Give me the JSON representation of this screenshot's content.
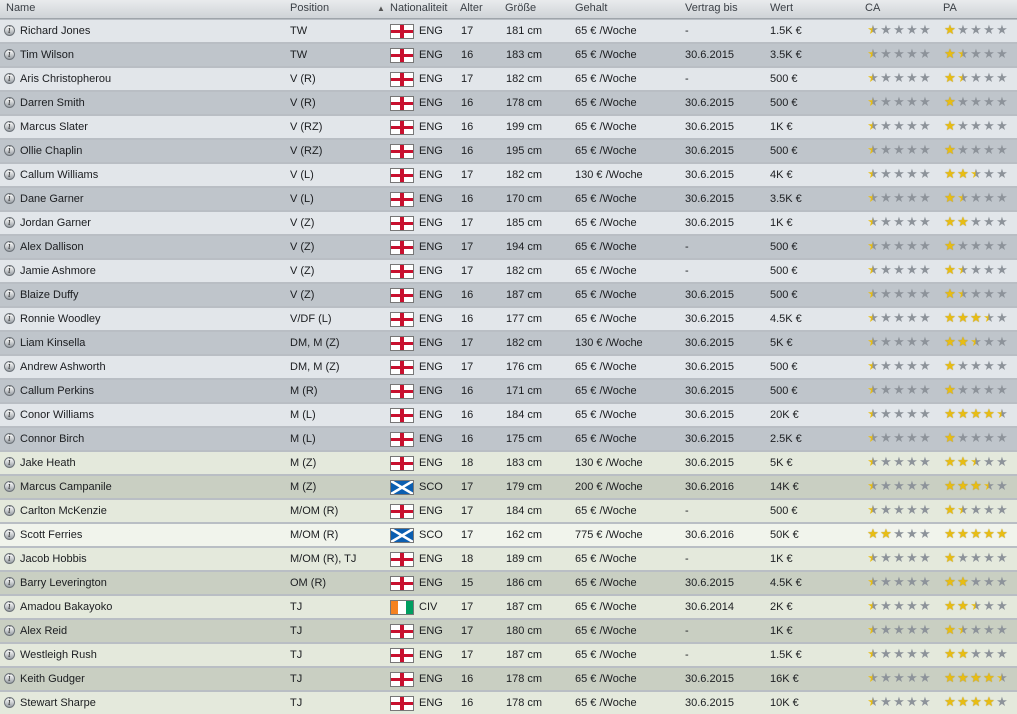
{
  "columns": [
    {
      "key": "name",
      "label": "Name"
    },
    {
      "key": "position",
      "label": "Position"
    },
    {
      "key": "nat",
      "label": "Nationaliteit"
    },
    {
      "key": "age",
      "label": "Alter"
    },
    {
      "key": "height",
      "label": "Größe"
    },
    {
      "key": "salary",
      "label": "Gehalt"
    },
    {
      "key": "contract",
      "label": "Vertrag bis"
    },
    {
      "key": "value",
      "label": "Wert"
    },
    {
      "key": "ca",
      "label": "CA"
    },
    {
      "key": "pa",
      "label": "PA"
    }
  ],
  "info_icon_glyph": "i",
  "sort_glyph": "▲",
  "star_glyph": "★",
  "colors": {
    "star_gold": "#e8bd13",
    "star_grey": "#8d939a",
    "eng_red": "#c8102e",
    "sco_blue": "#0b5eb0"
  },
  "players": [
    {
      "name": "Richard Jones",
      "position": "TW",
      "nat": "ENG",
      "flag": "eng",
      "age": "17",
      "height": "181 cm",
      "salary": "65 € /Woche",
      "contract": "-",
      "value": "1.5K €",
      "ca": 0.5,
      "pa": 1.0,
      "tint": "grey"
    },
    {
      "name": "Tim Wilson",
      "position": "TW",
      "nat": "ENG",
      "flag": "eng",
      "age": "16",
      "height": "183 cm",
      "salary": "65 € /Woche",
      "contract": "30.6.2015",
      "value": "3.5K €",
      "ca": 0.5,
      "pa": 1.5,
      "tint": "grey"
    },
    {
      "name": "Aris Christopherou",
      "position": "V (R)",
      "nat": "ENG",
      "flag": "eng",
      "age": "17",
      "height": "182 cm",
      "salary": "65 € /Woche",
      "contract": "-",
      "value": "500 €",
      "ca": 0.5,
      "pa": 1.5,
      "tint": "grey"
    },
    {
      "name": "Darren Smith",
      "position": "V (R)",
      "nat": "ENG",
      "flag": "eng",
      "age": "16",
      "height": "178 cm",
      "salary": "65 € /Woche",
      "contract": "30.6.2015",
      "value": "500 €",
      "ca": 0.5,
      "pa": 1.0,
      "tint": "grey"
    },
    {
      "name": "Marcus Slater",
      "position": "V (RZ)",
      "nat": "ENG",
      "flag": "eng",
      "age": "16",
      "height": "199 cm",
      "salary": "65 € /Woche",
      "contract": "30.6.2015",
      "value": "1K €",
      "ca": 0.5,
      "pa": 1.0,
      "tint": "grey"
    },
    {
      "name": "Ollie Chaplin",
      "position": "V (RZ)",
      "nat": "ENG",
      "flag": "eng",
      "age": "16",
      "height": "195 cm",
      "salary": "65 € /Woche",
      "contract": "30.6.2015",
      "value": "500 €",
      "ca": 0.5,
      "pa": 1.0,
      "tint": "grey"
    },
    {
      "name": "Callum Williams",
      "position": "V (L)",
      "nat": "ENG",
      "flag": "eng",
      "age": "17",
      "height": "182 cm",
      "salary": "130 € /Woche",
      "contract": "30.6.2015",
      "value": "4K €",
      "ca": 0.5,
      "pa": 2.5,
      "tint": "grey"
    },
    {
      "name": "Dane Garner",
      "position": "V (L)",
      "nat": "ENG",
      "flag": "eng",
      "age": "16",
      "height": "170 cm",
      "salary": "65 € /Woche",
      "contract": "30.6.2015",
      "value": "3.5K €",
      "ca": 0.5,
      "pa": 1.5,
      "tint": "grey"
    },
    {
      "name": "Jordan Garner",
      "position": "V (Z)",
      "nat": "ENG",
      "flag": "eng",
      "age": "17",
      "height": "185 cm",
      "salary": "65 € /Woche",
      "contract": "30.6.2015",
      "value": "1K €",
      "ca": 0.5,
      "pa": 2.0,
      "tint": "grey"
    },
    {
      "name": "Alex Dallison",
      "position": "V (Z)",
      "nat": "ENG",
      "flag": "eng",
      "age": "17",
      "height": "194 cm",
      "salary": "65 € /Woche",
      "contract": "-",
      "value": "500 €",
      "ca": 0.5,
      "pa": 1.0,
      "tint": "grey"
    },
    {
      "name": "Jamie Ashmore",
      "position": "V (Z)",
      "nat": "ENG",
      "flag": "eng",
      "age": "17",
      "height": "182 cm",
      "salary": "65 € /Woche",
      "contract": "-",
      "value": "500 €",
      "ca": 0.5,
      "pa": 1.5,
      "tint": "grey"
    },
    {
      "name": "Blaize Duffy",
      "position": "V (Z)",
      "nat": "ENG",
      "flag": "eng",
      "age": "16",
      "height": "187 cm",
      "salary": "65 € /Woche",
      "contract": "30.6.2015",
      "value": "500 €",
      "ca": 0.5,
      "pa": 1.5,
      "tint": "grey"
    },
    {
      "name": "Ronnie Woodley",
      "position": "V/DF (L)",
      "nat": "ENG",
      "flag": "eng",
      "age": "16",
      "height": "177 cm",
      "salary": "65 € /Woche",
      "contract": "30.6.2015",
      "value": "4.5K €",
      "ca": 0.5,
      "pa": 3.5,
      "tint": "grey"
    },
    {
      "name": "Liam Kinsella",
      "position": "DM, M (Z)",
      "nat": "ENG",
      "flag": "eng",
      "age": "17",
      "height": "182 cm",
      "salary": "130 € /Woche",
      "contract": "30.6.2015",
      "value": "5K €",
      "ca": 0.5,
      "pa": 2.5,
      "tint": "grey"
    },
    {
      "name": "Andrew Ashworth",
      "position": "DM, M (Z)",
      "nat": "ENG",
      "flag": "eng",
      "age": "17",
      "height": "176 cm",
      "salary": "65 € /Woche",
      "contract": "30.6.2015",
      "value": "500 €",
      "ca": 0.5,
      "pa": 1.0,
      "tint": "grey"
    },
    {
      "name": "Callum Perkins",
      "position": "M (R)",
      "nat": "ENG",
      "flag": "eng",
      "age": "16",
      "height": "171 cm",
      "salary": "65 € /Woche",
      "contract": "30.6.2015",
      "value": "500 €",
      "ca": 0.5,
      "pa": 1.0,
      "tint": "grey"
    },
    {
      "name": "Conor Williams",
      "position": "M (L)",
      "nat": "ENG",
      "flag": "eng",
      "age": "16",
      "height": "184 cm",
      "salary": "65 € /Woche",
      "contract": "30.6.2015",
      "value": "20K €",
      "ca": 0.5,
      "pa": 4.5,
      "tint": "grey"
    },
    {
      "name": "Connor Birch",
      "position": "M (L)",
      "nat": "ENG",
      "flag": "eng",
      "age": "16",
      "height": "175 cm",
      "salary": "65 € /Woche",
      "contract": "30.6.2015",
      "value": "2.5K €",
      "ca": 0.5,
      "pa": 1.0,
      "tint": "grey"
    },
    {
      "name": "Jake Heath",
      "position": "M (Z)",
      "nat": "ENG",
      "flag": "eng",
      "age": "18",
      "height": "183 cm",
      "salary": "130 € /Woche",
      "contract": "30.6.2015",
      "value": "5K €",
      "ca": 0.5,
      "pa": 2.5,
      "tint": "green"
    },
    {
      "name": "Marcus Campanile",
      "position": "M (Z)",
      "nat": "SCO",
      "flag": "sco",
      "age": "17",
      "height": "179 cm",
      "salary": "200 € /Woche",
      "contract": "30.6.2016",
      "value": "14K €",
      "ca": 0.5,
      "pa": 3.5,
      "tint": "green"
    },
    {
      "name": "Carlton McKenzie",
      "position": "M/OM (R)",
      "nat": "ENG",
      "flag": "eng",
      "age": "17",
      "height": "184 cm",
      "salary": "65 € /Woche",
      "contract": "-",
      "value": "500 €",
      "ca": 0.5,
      "pa": 1.5,
      "tint": "green"
    },
    {
      "name": "Scott Ferries",
      "position": "M/OM (R)",
      "nat": "SCO",
      "flag": "sco",
      "age": "17",
      "height": "162 cm",
      "salary": "775 € /Woche",
      "contract": "30.6.2016",
      "value": "50K €",
      "ca": 2.0,
      "pa": 5.0,
      "tint": "sel"
    },
    {
      "name": "Jacob Hobbis",
      "position": "M/OM (R), TJ",
      "nat": "ENG",
      "flag": "eng",
      "age": "18",
      "height": "189 cm",
      "salary": "65 € /Woche",
      "contract": "-",
      "value": "1K €",
      "ca": 0.5,
      "pa": 1.0,
      "tint": "green"
    },
    {
      "name": "Barry Leverington",
      "position": "OM (R)",
      "nat": "ENG",
      "flag": "eng",
      "age": "15",
      "height": "186 cm",
      "salary": "65 € /Woche",
      "contract": "30.6.2015",
      "value": "4.5K €",
      "ca": 0.5,
      "pa": 2.0,
      "tint": "green"
    },
    {
      "name": "Amadou Bakayoko",
      "position": "TJ",
      "nat": "CIV",
      "flag": "civ",
      "age": "17",
      "height": "187 cm",
      "salary": "65 € /Woche",
      "contract": "30.6.2014",
      "value": "2K €",
      "ca": 0.5,
      "pa": 2.5,
      "tint": "green"
    },
    {
      "name": "Alex Reid",
      "position": "TJ",
      "nat": "ENG",
      "flag": "eng",
      "age": "17",
      "height": "180 cm",
      "salary": "65 € /Woche",
      "contract": "-",
      "value": "1K €",
      "ca": 0.5,
      "pa": 1.5,
      "tint": "green"
    },
    {
      "name": "Westleigh Rush",
      "position": "TJ",
      "nat": "ENG",
      "flag": "eng",
      "age": "17",
      "height": "187 cm",
      "salary": "65 € /Woche",
      "contract": "-",
      "value": "1.5K €",
      "ca": 0.5,
      "pa": 2.0,
      "tint": "green"
    },
    {
      "name": "Keith Gudger",
      "position": "TJ",
      "nat": "ENG",
      "flag": "eng",
      "age": "16",
      "height": "178 cm",
      "salary": "65 € /Woche",
      "contract": "30.6.2015",
      "value": "16K €",
      "ca": 0.5,
      "pa": 4.5,
      "tint": "green"
    },
    {
      "name": "Stewart Sharpe",
      "position": "TJ",
      "nat": "ENG",
      "flag": "eng",
      "age": "16",
      "height": "178 cm",
      "salary": "65 € /Woche",
      "contract": "30.6.2015",
      "value": "10K €",
      "ca": 0.5,
      "pa": 4.0,
      "tint": "green"
    }
  ]
}
